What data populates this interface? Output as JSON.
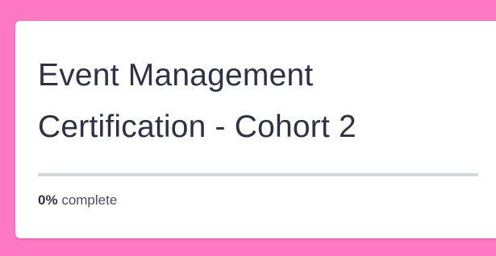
{
  "course": {
    "title": "Event Management Certification - Cohort 2",
    "progress": {
      "percent": 0,
      "percent_label": "0%",
      "suffix": "complete"
    }
  },
  "colors": {
    "background": "#ff78c4",
    "card": "#ffffff",
    "title_text": "#2f3246",
    "progress_track": "#d3d5dd"
  }
}
